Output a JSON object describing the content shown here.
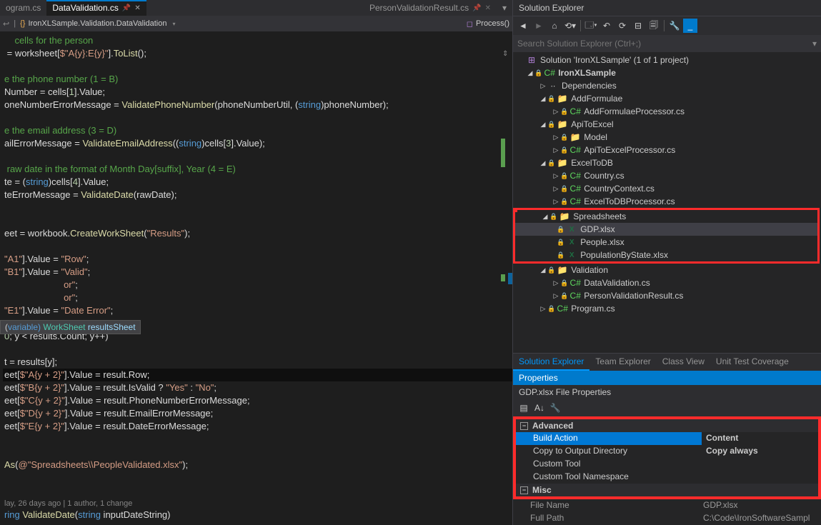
{
  "tabs": {
    "left": "ogram.cs",
    "active": "DataValidation.cs",
    "right": "PersonValidationResult.cs"
  },
  "context": {
    "namespace": "IronXLSample.Validation.DataValidation",
    "method": "Process()"
  },
  "code_lines": [
    {
      "t": "    cells for the person",
      "cls": "c-cmt"
    },
    {
      "t": " = worksheet[$\"A{y}:E{y}\"].ToList();",
      "parts": [
        [
          "",
          "p"
        ],
        [
          " = worksheet[",
          "p"
        ],
        [
          "$\"A{y}:E{y}\"",
          "str"
        ],
        [
          "].",
          "p"
        ],
        [
          "ToList",
          "fn"
        ],
        [
          "();",
          "p"
        ]
      ]
    },
    {
      "t": ""
    },
    {
      "t": "e the phone number (1 = B)",
      "cls": "c-cmt"
    },
    {
      "t": "Number = cells[1].Value;",
      "parts": [
        [
          "Number = cells[",
          "p"
        ],
        [
          "1",
          "num"
        ],
        [
          "].Value;",
          "p"
        ]
      ]
    },
    {
      "t": "oneNumberErrorMessage = ValidatePhoneNumber(phoneNumberUtil, (string)phoneNumber);",
      "parts": [
        [
          "oneNumberErrorMessage = ",
          "p"
        ],
        [
          "ValidatePhoneNumber",
          "fn"
        ],
        [
          "(phoneNumberUtil, (",
          "p"
        ],
        [
          "string",
          "kw"
        ],
        [
          ")phoneNumber);",
          "p"
        ]
      ]
    },
    {
      "t": ""
    },
    {
      "t": "e the email address (3 = D)",
      "cls": "c-cmt"
    },
    {
      "t": "ailErrorMessage = ValidateEmailAddress((string)cells[3].Value);",
      "parts": [
        [
          "ailErrorMessage = ",
          "p"
        ],
        [
          "ValidateEmailAddress",
          "fn"
        ],
        [
          "((",
          "p"
        ],
        [
          "string",
          "kw"
        ],
        [
          ")cells[",
          "p"
        ],
        [
          "3",
          "num"
        ],
        [
          "].Value);",
          "p"
        ]
      ]
    },
    {
      "t": ""
    },
    {
      "t": " raw date in the format of Month Day[suffix], Year (4 = E)",
      "cls": "c-cmt"
    },
    {
      "t": "te = (string)cells[4].Value;",
      "parts": [
        [
          "te = (",
          "p"
        ],
        [
          "string",
          "kw"
        ],
        [
          ")cells[",
          "p"
        ],
        [
          "4",
          "num"
        ],
        [
          "].Value;",
          "p"
        ]
      ]
    },
    {
      "t": "teErrorMessage = ValidateDate(rawDate);",
      "parts": [
        [
          "teErrorMessage = ",
          "p"
        ],
        [
          "ValidateDate",
          "fn"
        ],
        [
          "(rawDate);",
          "p"
        ]
      ]
    },
    {
      "t": ""
    },
    {
      "t": ""
    },
    {
      "t": "eet = workbook.CreateWorkSheet(\"Results\");",
      "parts": [
        [
          "eet = workbook.",
          "p"
        ],
        [
          "CreateWorkSheet",
          "fn"
        ],
        [
          "(",
          "p"
        ],
        [
          "\"Results\"",
          "str"
        ],
        [
          ");",
          "p"
        ]
      ]
    },
    {
      "t": ""
    },
    {
      "t": "\"A1\"].Value = \"Row\";",
      "parts": [
        [
          "",
          "p"
        ],
        [
          "\"A1\"",
          "str"
        ],
        [
          "].Value = ",
          "p"
        ],
        [
          "\"Row\"",
          "str"
        ],
        [
          ";",
          "p"
        ]
      ]
    },
    {
      "t": "\"B1\"].Value = \"Valid\";",
      "parts": [
        [
          "",
          "p"
        ],
        [
          "\"B1\"",
          "str"
        ],
        [
          "].Value = ",
          "p"
        ],
        [
          "\"Valid\"",
          "str"
        ],
        [
          ";",
          "p"
        ]
      ]
    },
    {
      "t": "                       or\";",
      "parts": [
        [
          "                       ",
          "p"
        ],
        [
          "or\"",
          "str"
        ],
        [
          ";",
          "p"
        ]
      ]
    },
    {
      "t": "                       or\";",
      "parts": [
        [
          "                       ",
          "p"
        ],
        [
          "or\"",
          "str"
        ],
        [
          ";",
          "p"
        ]
      ]
    },
    {
      "t": "\"E1\"].Value = \"Date Error\";",
      "parts": [
        [
          "",
          "p"
        ],
        [
          "\"E1\"",
          "str"
        ],
        [
          "].Value = ",
          "p"
        ],
        [
          "\"Date Error\"",
          "str"
        ],
        [
          ";",
          "p"
        ]
      ]
    },
    {
      "t": ""
    },
    {
      "t": "0; y < results.Count; y++)",
      "parts": [
        [
          "",
          "p"
        ],
        [
          "0",
          "num"
        ],
        [
          "; y < results.Count; y++)",
          "p"
        ]
      ]
    },
    {
      "t": ""
    },
    {
      "t": "t = results[y];"
    },
    {
      "t": "eet[$\"A{y + 2}\"].Value = result.Row;",
      "parts": [
        [
          "eet[",
          "p"
        ],
        [
          "$\"A{y + 2}\"",
          "str"
        ],
        [
          "].Value = result.Row;",
          "p"
        ]
      ],
      "hl": true
    },
    {
      "t": "eet[$\"B{y + 2}\"].Value = result.IsValid ? \"Yes\" : \"No\";",
      "parts": [
        [
          "eet[",
          "p"
        ],
        [
          "$\"B{y + 2}\"",
          "str"
        ],
        [
          "].Value = result.IsValid ? ",
          "p"
        ],
        [
          "\"Yes\"",
          "str"
        ],
        [
          " : ",
          "p"
        ],
        [
          "\"No\"",
          "str"
        ],
        [
          ";",
          "p"
        ]
      ]
    },
    {
      "t": "eet[$\"C{y + 2}\"].Value = result.PhoneNumberErrorMessage;",
      "parts": [
        [
          "eet[",
          "p"
        ],
        [
          "$\"C{y + 2}\"",
          "str"
        ],
        [
          "].Value = result.PhoneNumberErrorMessage;",
          "p"
        ]
      ]
    },
    {
      "t": "eet[$\"D{y + 2}\"].Value = result.EmailErrorMessage;",
      "parts": [
        [
          "eet[",
          "p"
        ],
        [
          "$\"D{y + 2}\"",
          "str"
        ],
        [
          "].Value = result.EmailErrorMessage;",
          "p"
        ]
      ]
    },
    {
      "t": "eet[$\"E{y + 2}\"].Value = result.DateErrorMessage;",
      "parts": [
        [
          "eet[",
          "p"
        ],
        [
          "$\"E{y + 2}\"",
          "str"
        ],
        [
          "].Value = result.DateErrorMessage;",
          "p"
        ]
      ]
    },
    {
      "t": ""
    },
    {
      "t": ""
    },
    {
      "t": "As(@\"Spreadsheets\\\\PeopleValidated.xlsx\");",
      "parts": [
        [
          "",
          "p"
        ],
        [
          "As",
          "fn"
        ],
        [
          "(",
          "p"
        ],
        [
          "@\"Spreadsheets\\\\PeopleValidated.xlsx\"",
          "str"
        ],
        [
          ");",
          "p"
        ]
      ]
    },
    {
      "t": ""
    },
    {
      "t": ""
    }
  ],
  "codelens": "lay, 26 days ago | 1 author, 1 change",
  "code_tail": "ring ValidateDate(string inputDateString)",
  "tooltip": {
    "prefix": "variable)",
    "type": "WorkSheet",
    "name": "resultsSheet"
  },
  "explorer": {
    "title": "Solution Explorer",
    "search_placeholder": "Search Solution Explorer (Ctrl+;)",
    "solution": "Solution 'IronXLSample' (1 of 1 project)",
    "project": "IronXLSample",
    "nodes": {
      "dependencies": "Dependencies",
      "addformulae": "AddFormulae",
      "addformulaeproc": "AddFormulaeProcessor.cs",
      "apitoexcel": "ApiToExcel",
      "model": "Model",
      "apitoexcelproc": "ApiToExcelProcessor.cs",
      "exceltodb": "ExcelToDB",
      "country": "Country.cs",
      "countryctx": "CountryContext.cs",
      "exceltodbproc": "ExcelToDBProcessor.cs",
      "spreadsheets": "Spreadsheets",
      "gdp": "GDP.xlsx",
      "people": "People.xlsx",
      "population": "PopulationByState.xlsx",
      "validation": "Validation",
      "datavalidation": "DataValidation.cs",
      "personvr": "PersonValidationResult.cs",
      "program": "Program.cs"
    }
  },
  "panel_tabs": {
    "t0": "Solution Explorer",
    "t1": "Team Explorer",
    "t2": "Class View",
    "t3": "Unit Test Coverage"
  },
  "props": {
    "title": "Properties",
    "selection": "GDP.xlsx File Properties",
    "cat_adv": "Advanced",
    "cat_misc": "Misc",
    "rows": {
      "build": {
        "k": "Build Action",
        "v": "Content"
      },
      "copy": {
        "k": "Copy to Output Directory",
        "v": "Copy always"
      },
      "tool": {
        "k": "Custom Tool",
        "v": ""
      },
      "toolns": {
        "k": "Custom Tool Namespace",
        "v": ""
      },
      "fname": {
        "k": "File Name",
        "v": "GDP.xlsx"
      },
      "fpath": {
        "k": "Full Path",
        "v": "C:\\Code\\IronSoftwareSampl"
      }
    }
  }
}
